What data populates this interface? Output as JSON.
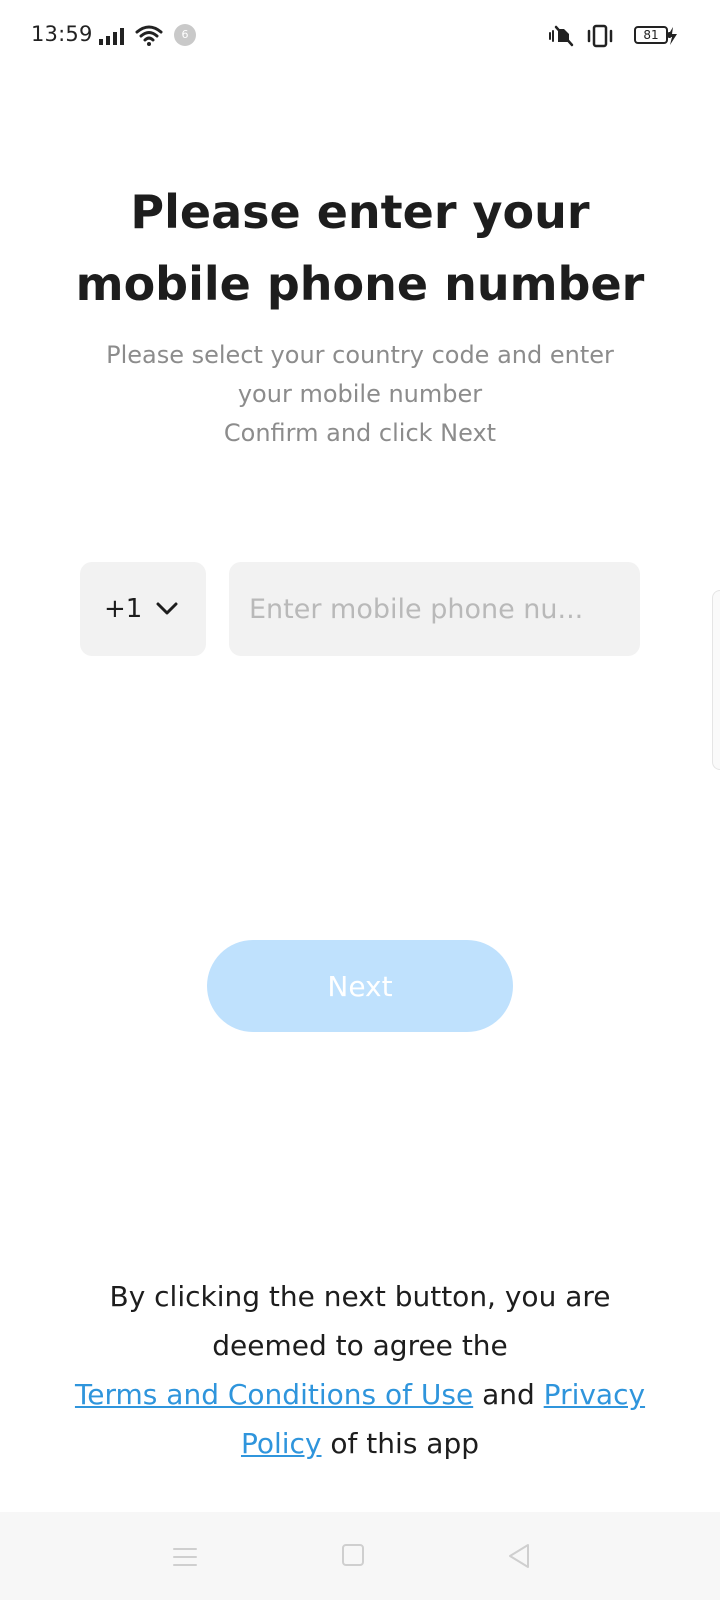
{
  "status_bar": {
    "time": "13:59",
    "notification_count": "6",
    "battery_level": "81",
    "icons": [
      "signal-icon",
      "wifi-icon",
      "vibrate-off-icon",
      "vibrate-icon",
      "battery-icon",
      "charging-icon"
    ]
  },
  "header": {
    "title_line1": "Please enter your",
    "title_line2": "mobile phone number",
    "subtitle_line1": "Please select your country code and enter",
    "subtitle_line2": "your mobile number",
    "subtitle_line3": "Confirm and click Next"
  },
  "form": {
    "country_code": "+1",
    "phone_value": "",
    "phone_placeholder": "Enter mobile phone nu..."
  },
  "actions": {
    "next_label": "Next",
    "next_enabled": false
  },
  "terms": {
    "line1": "By clicking the next button, you are",
    "line2": "deemed to agree the",
    "terms_link": "Terms and Conditions of Use",
    "and": "and",
    "privacy_link": "Privacy",
    "privacy_link_cont": "Policy",
    "tail": "of this app"
  },
  "nav_bar": {
    "buttons": [
      "menu-icon",
      "home-icon",
      "back-icon"
    ]
  },
  "colors": {
    "accent": "#2f95dc",
    "button_disabled": "#bfe1fd",
    "input_bg": "#f2f2f2",
    "subtitle": "#8c8c8c"
  }
}
